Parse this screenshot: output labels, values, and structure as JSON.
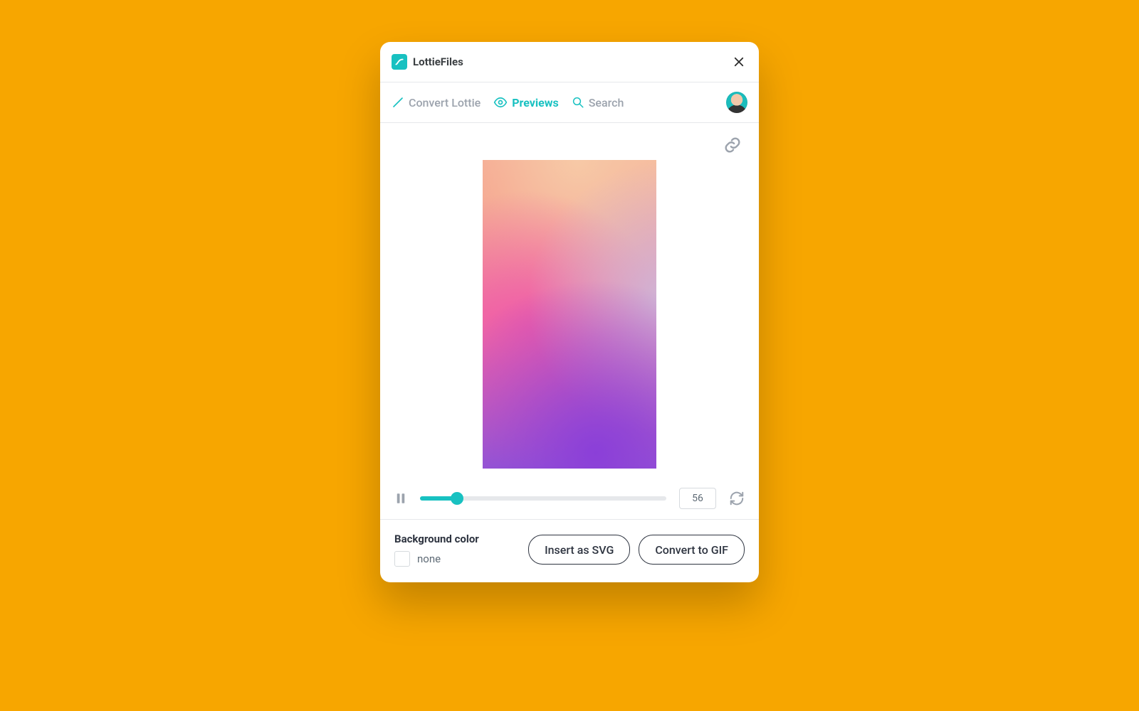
{
  "header": {
    "title": "LottieFiles"
  },
  "tabs": {
    "items": [
      {
        "label": "Convert Lottie"
      },
      {
        "label": "Previews"
      },
      {
        "label": "Search"
      }
    ],
    "active_index": 1
  },
  "player": {
    "frame": "56",
    "progress_pct": 15
  },
  "footer": {
    "bg_label": "Background color",
    "bg_value": "none",
    "insert_svg_label": "Insert as SVG",
    "convert_gif_label": "Convert to GIF"
  },
  "colors": {
    "accent": "#18c1c1",
    "page_bg": "#f7a600"
  }
}
